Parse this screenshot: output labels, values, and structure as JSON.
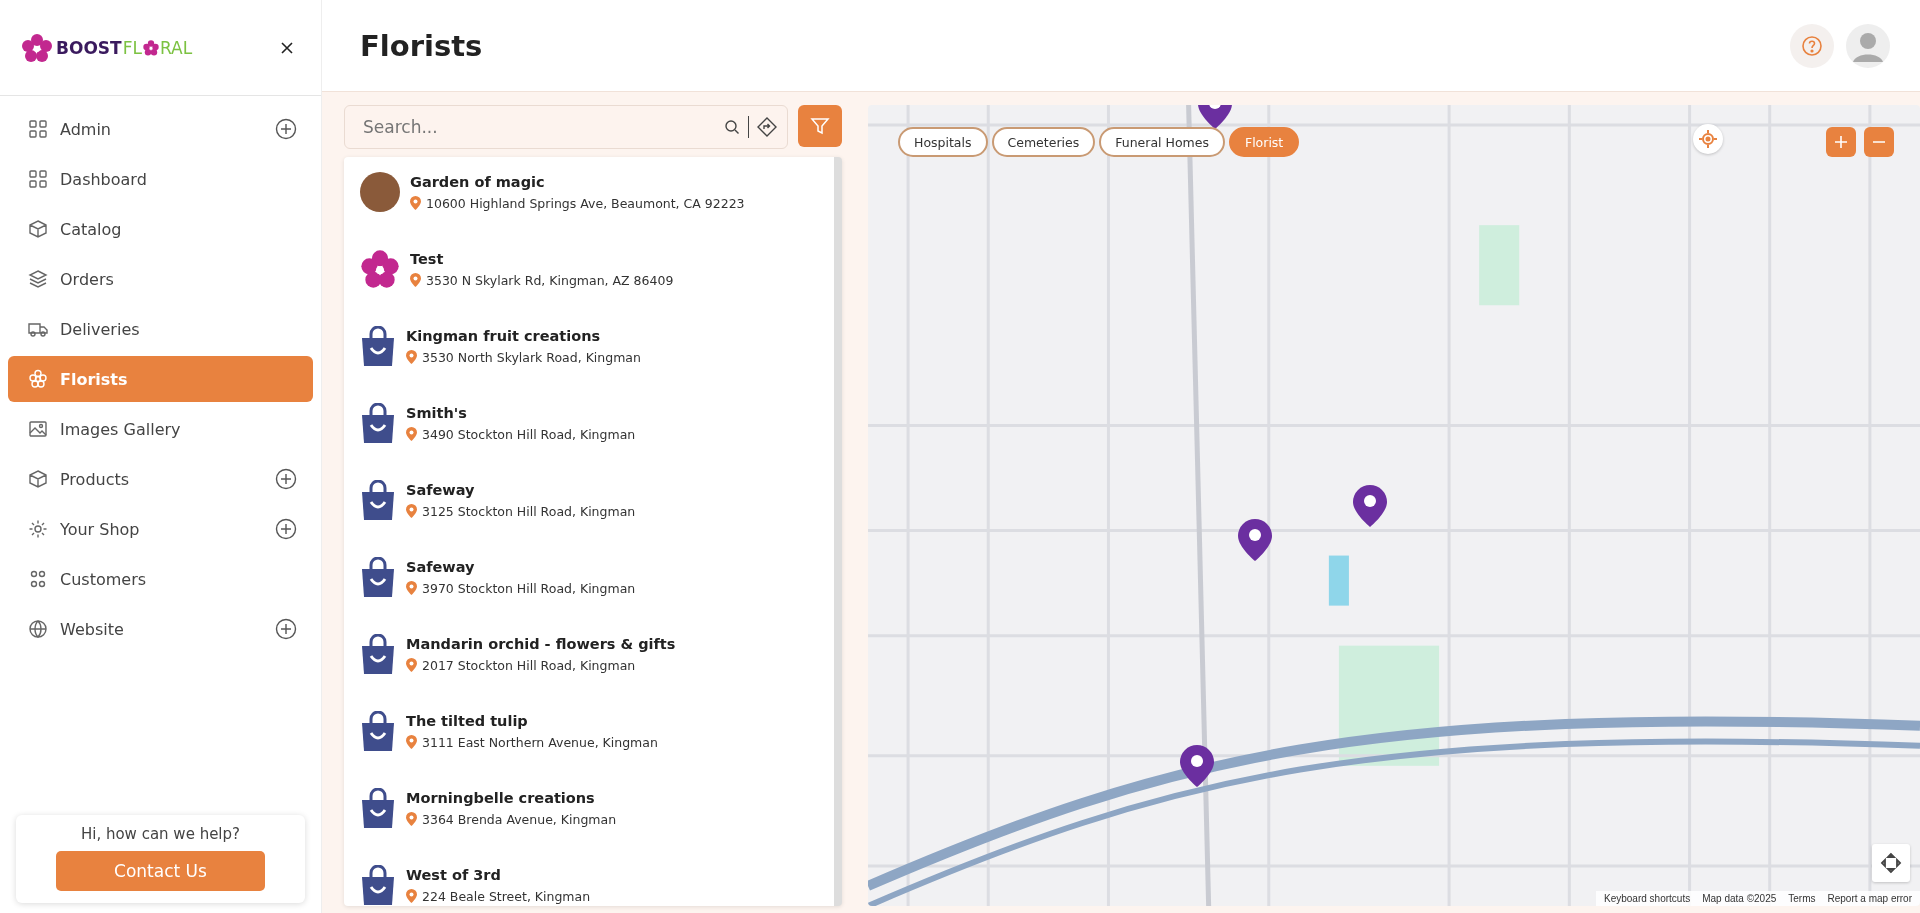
{
  "logo": {
    "part1": "BOOST",
    "part2": "FL",
    "part3": "RAL"
  },
  "page_title": "Florists",
  "sidebar": {
    "items": [
      {
        "label": "Admin",
        "expandable": true,
        "selected": false
      },
      {
        "label": "Dashboard",
        "expandable": false,
        "selected": false
      },
      {
        "label": "Catalog",
        "expandable": false,
        "selected": false
      },
      {
        "label": "Orders",
        "expandable": false,
        "selected": false
      },
      {
        "label": "Deliveries",
        "expandable": false,
        "selected": false
      },
      {
        "label": "Florists",
        "expandable": false,
        "selected": true
      },
      {
        "label": "Images Gallery",
        "expandable": false,
        "selected": false
      },
      {
        "label": "Products",
        "expandable": true,
        "selected": false
      },
      {
        "label": "Your Shop",
        "expandable": true,
        "selected": false
      },
      {
        "label": "Customers",
        "expandable": false,
        "selected": false
      },
      {
        "label": "Website",
        "expandable": true,
        "selected": false
      }
    ],
    "help": {
      "text": "Hi, how can we help?",
      "button": "Contact Us"
    }
  },
  "search": {
    "placeholder": "Search..."
  },
  "florists": [
    {
      "name": "Garden of magic",
      "address": "10600 Highland Springs Ave, Beaumont, CA 92223",
      "kind": "photo"
    },
    {
      "name": "Test",
      "address": "3530 N Skylark Rd, Kingman, AZ 86409",
      "kind": "flower"
    },
    {
      "name": "Kingman fruit creations",
      "address": "3530 North Skylark Road, Kingman",
      "kind": "bag"
    },
    {
      "name": "Smith's",
      "address": "3490 Stockton Hill Road, Kingman",
      "kind": "bag"
    },
    {
      "name": "Safeway",
      "address": "3125 Stockton Hill Road, Kingman",
      "kind": "bag"
    },
    {
      "name": "Safeway",
      "address": "3970 Stockton Hill Road, Kingman",
      "kind": "bag"
    },
    {
      "name": "Mandarin orchid - flowers & gifts",
      "address": "2017 Stockton Hill Road, Kingman",
      "kind": "bag"
    },
    {
      "name": "The tilted tulip",
      "address": "3111 East Northern Avenue, Kingman",
      "kind": "bag"
    },
    {
      "name": "Morningbelle creations",
      "address": "3364 Brenda Avenue, Kingman",
      "kind": "bag"
    },
    {
      "name": "West of 3rd",
      "address": "224 Beale Street, Kingman",
      "kind": "bag"
    }
  ],
  "map": {
    "chips": [
      {
        "label": "Hospitals",
        "selected": false
      },
      {
        "label": "Cemeteries",
        "selected": false
      },
      {
        "label": "Funeral Homes",
        "selected": false
      },
      {
        "label": "Florist",
        "selected": true
      }
    ],
    "footer": [
      "Keyboard shortcuts",
      "Map data ©2025",
      "Terms",
      "Report a map error"
    ]
  }
}
